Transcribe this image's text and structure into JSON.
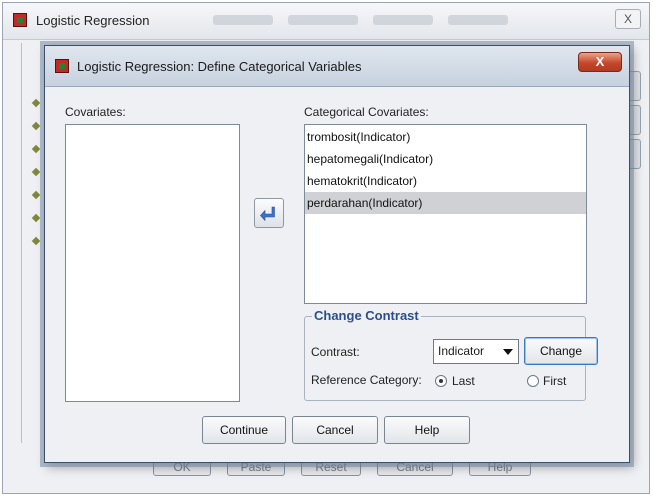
{
  "background_window": {
    "title": "Logistic Regression",
    "close_glyph": "X",
    "bottom_buttons": [
      "OK",
      "Paste",
      "Reset",
      "Cancel",
      "Help"
    ]
  },
  "dialog": {
    "title": "Logistic Regression: Define Categorical Variables",
    "close_glyph": "X",
    "covariates_label": "Covariates:",
    "covariates": [],
    "categorical_label": "Categorical Covariates:",
    "categorical_covariates": [
      "trombosit(Indicator)",
      "hepatomegali(Indicator)",
      "hematokrit(Indicator)",
      "perdarahan(Indicator)"
    ],
    "selected_index": 3,
    "move_icon": "arrow-left-icon",
    "change_contrast": {
      "title": "Change Contrast",
      "contrast_label": "Contrast:",
      "contrast_value": "Indicator",
      "change_button": "Change",
      "reference_label": "Reference Category:",
      "last_label": "Last",
      "first_label": "First",
      "selected_reference": "Last"
    },
    "buttons": {
      "continue": "Continue",
      "cancel": "Cancel",
      "help": "Help"
    }
  },
  "colors": {
    "group_title": "#2b4f8c",
    "close_button": "#c4482c",
    "arrow_icon": "#3f73c8",
    "selected_row": "#cfd1d5"
  }
}
